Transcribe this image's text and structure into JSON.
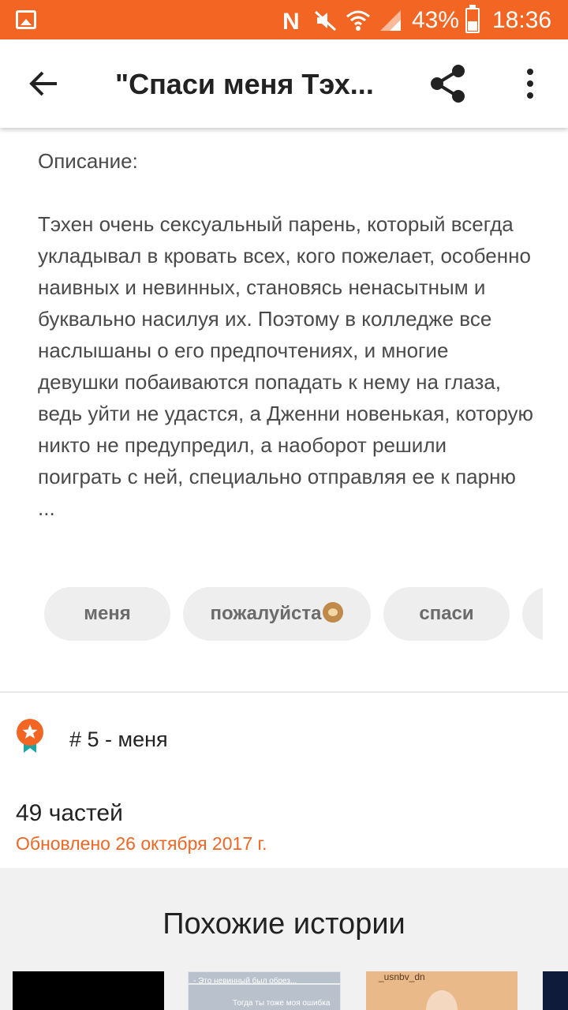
{
  "status_bar": {
    "battery": "43%",
    "time": "18:36",
    "icons": [
      "gallery-icon",
      "nfc-icon",
      "mute-icon",
      "wifi-icon",
      "signal-icon",
      "battery-icon"
    ],
    "background": "#f26522"
  },
  "app_bar": {
    "title": "\"Спаси меня Тэх...",
    "back_icon": "arrow-left-icon",
    "share_icon": "share-icon",
    "more_icon": "more-vertical-icon"
  },
  "description": {
    "label": "Описание:",
    "text": "Тэхен очень сексуальный парень, который всегда укладывал в кровать всех, кого пожелает, особенно наивных и невинных, становясь ненасытным и буквально насилуя их. Поэтому в колледже все наслышаны о его предпочтениях, и многие девушки побаиваются попадать к нему на глаза, ведь уйти не удастся, а Дженни новенькая, которую никто не предупредил, а наоборот решили поиграть с ней, специально отправляя ее к парню ..."
  },
  "tags": [
    {
      "label": "меня"
    },
    {
      "label": "пожалуйста",
      "emoji": "see-no-evil-monkey-emoji"
    },
    {
      "label": "спаси"
    }
  ],
  "ranking": {
    "text": "# 5 - меня",
    "icon": "medal-icon",
    "icon_color": "#f26522"
  },
  "stats": {
    "parts": "49 частей",
    "updated": "Обновлено 26 октября 2017 г.",
    "accent_color": "#f26522"
  },
  "similar": {
    "heading": "Похожие истории",
    "covers": [
      {
        "caption": ""
      },
      {
        "caption_top": "- Это невинный был обрез...",
        "caption_bottom": "Тогда ты тоже моя ошибка"
      },
      {
        "caption_top": "_usnbv_dn"
      },
      {
        "caption": ""
      }
    ]
  }
}
